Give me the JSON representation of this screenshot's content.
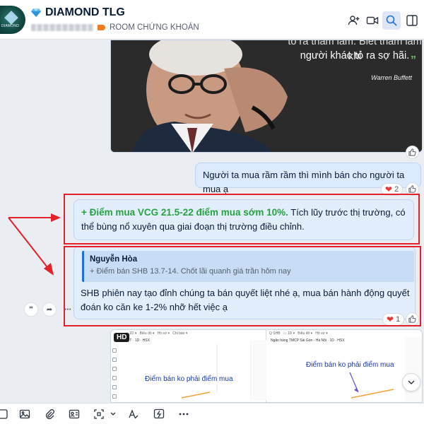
{
  "header": {
    "title": "DIAMOND TLG",
    "tag_label": "ROOM CHỨNG KHOÁN",
    "avatar_text": "DIAMOND"
  },
  "messages": {
    "quote_image": {
      "quote": "người khác tỏ ra sợ hãi.",
      "quote_top": "tỏ ra tham lam. Biết tham lam khi",
      "author": "Warren Buffett"
    },
    "sent_text": "Người ta mua rầm rầm thì mình bán cho người ta mua ạ",
    "sent_reaction_count": "2",
    "vcg_highlight": "+ Điểm mua VCG 21.5-22 điểm mua sớm 10%.",
    "vcg_rest": " Tích lũy trước thị trường, có thể bùng nổ xuyên qua giai đoạn thị trường điều chỉnh.",
    "reply": {
      "name": "Nguyễn Hòa",
      "quoted": "+ Điểm bán SHB 13.7-14. Chốt lãi quanh giá trần hôm nay",
      "text": "SHB phiên nay tạo đỉnh chúng ta bán quyết liệt nhé ạ, mua bán hành động quyết đoán ko căn ke 1-2% nhỡ hết việc ạ",
      "reaction_count": "1"
    },
    "chart_image": {
      "hd_label": "HD",
      "left_symbol": "FPT · 1D · HSX",
      "left_note": "Điểm bán ko phải điểm mua",
      "right_symbol": "Ngân hàng TMCP Sài Gòn - Hà Nội · 1D · HSX",
      "right_note": "Điểm bán ko phải điểm mua"
    }
  },
  "colors": {
    "accent": "#1f6fd8",
    "bubble": "#dbeafe",
    "highlight_green": "#26a340",
    "annotation_red": "#e4202b"
  }
}
